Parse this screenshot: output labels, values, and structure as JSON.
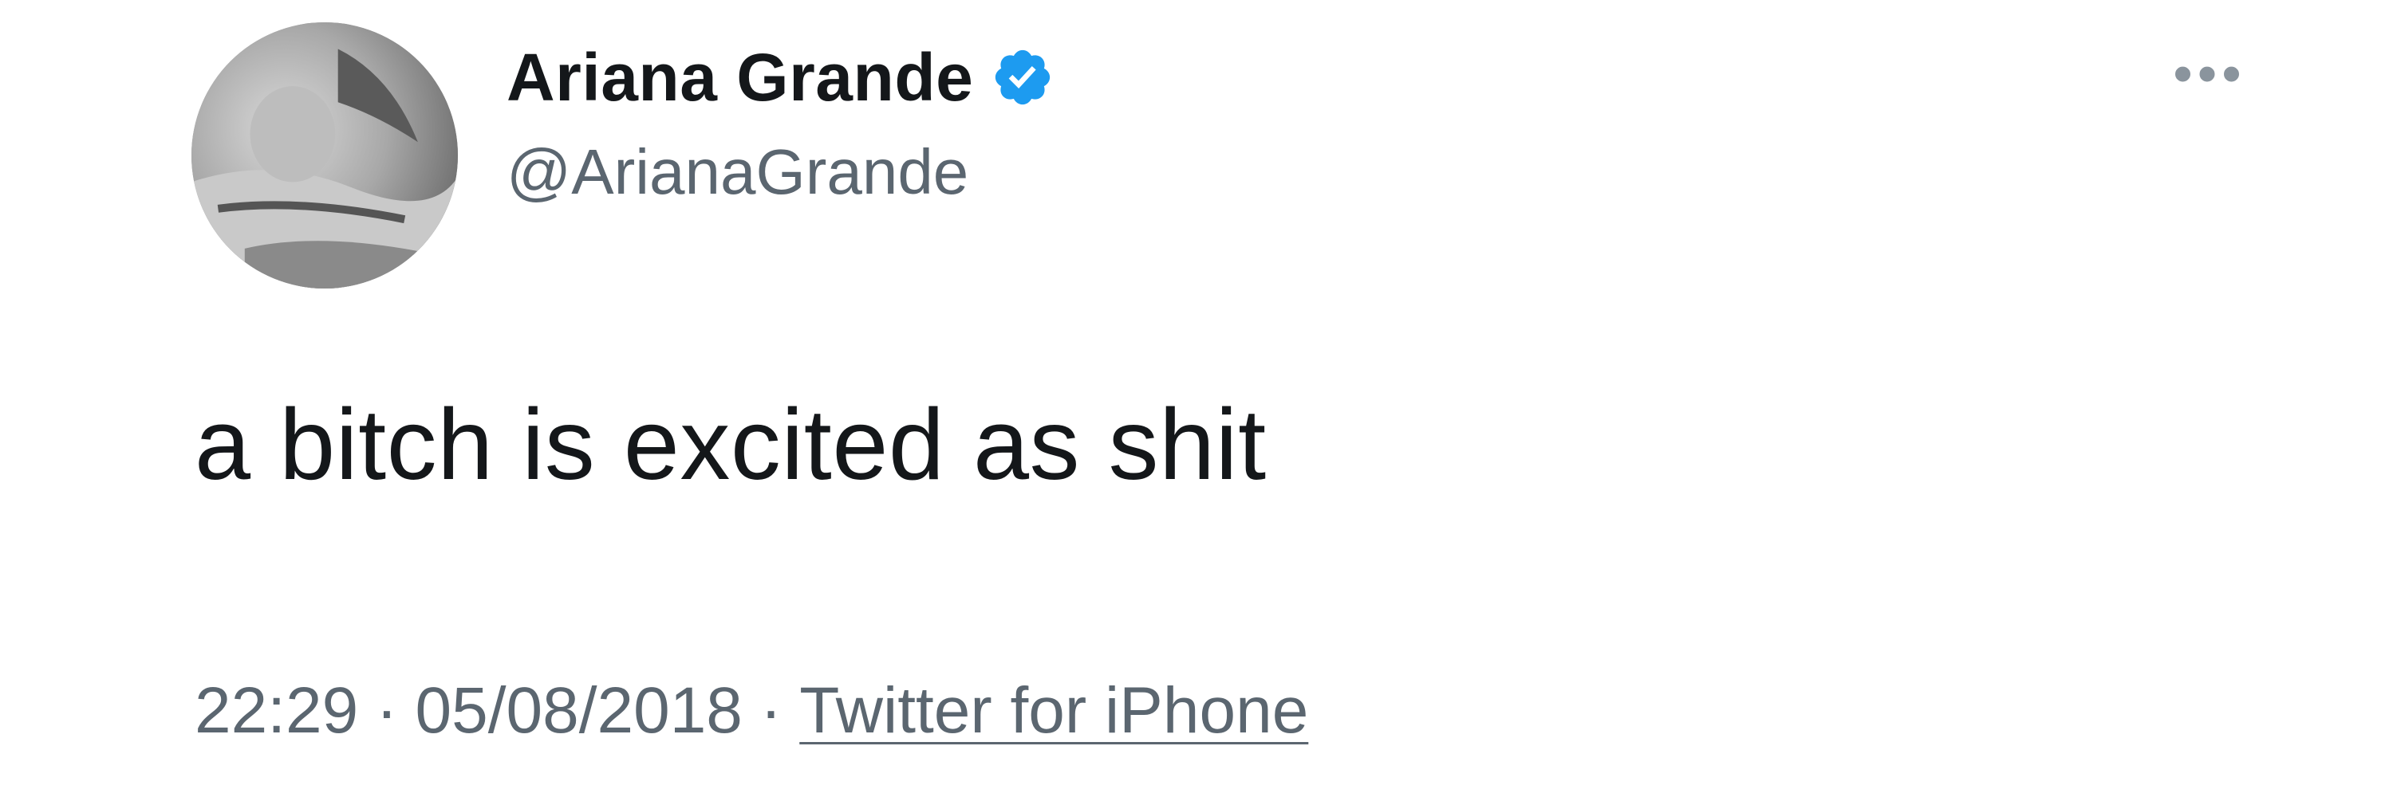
{
  "tweet": {
    "author": {
      "display_name": "Ariana Grande",
      "handle": "@ArianaGrande",
      "verified": true
    },
    "text": "a bitch is excited as shit",
    "time": "22:29",
    "date": "05/08/2018",
    "separator": "·",
    "source": "Twitter for iPhone",
    "more_label": "•••"
  },
  "icons": {
    "avatar": "profile-photo",
    "verified": "verified-badge-icon",
    "more": "more-options-icon"
  },
  "colors": {
    "verified_badge": "#1d9bf0",
    "text_primary": "#14171a",
    "text_secondary": "#5b6670"
  }
}
